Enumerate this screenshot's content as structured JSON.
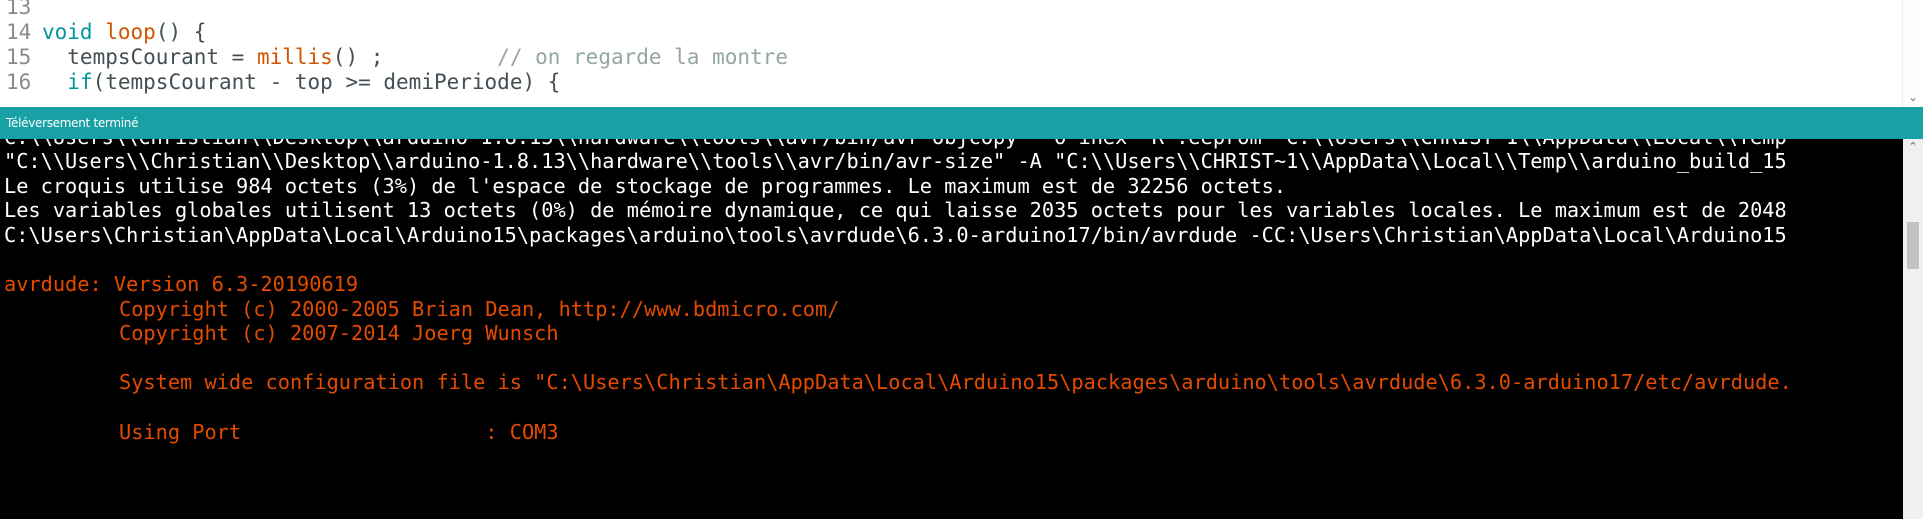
{
  "editor": {
    "lines": [
      {
        "num": "13",
        "parts": []
      },
      {
        "num": "14",
        "parts": [
          {
            "t": "void",
            "c": "kw"
          },
          {
            "t": " ",
            "c": ""
          },
          {
            "t": "loop",
            "c": "fn"
          },
          {
            "t": "() {",
            "c": ""
          }
        ]
      },
      {
        "num": "15",
        "parts": [
          {
            "t": "  tempsCourant = ",
            "c": ""
          },
          {
            "t": "millis",
            "c": "fn"
          },
          {
            "t": "() ;         ",
            "c": ""
          },
          {
            "t": "// on regarde la montre",
            "c": "cm"
          }
        ]
      },
      {
        "num": "16",
        "parts": [
          {
            "t": "  ",
            "c": ""
          },
          {
            "t": "if",
            "c": "kw"
          },
          {
            "t": "(tempsCourant - top >= demiPeriode) {",
            "c": ""
          }
        ]
      }
    ]
  },
  "status": {
    "text": "Téléversement terminé"
  },
  "console": {
    "clipped_top_line": "C:\\\\Users\\\\Christian\\\\Desktop\\\\arduino-1.8.13\\\\hardware\\\\tools\\\\avr/bin/avr-objcopy\" -O ihex -R .eeprom \"C:\\\\Users\\\\CHRIST~1\\\\AppData\\\\Local\\\\Temp",
    "lines": [
      {
        "text": "\"C:\\\\Users\\\\Christian\\\\Desktop\\\\arduino-1.8.13\\\\hardware\\\\tools\\\\avr/bin/avr-size\" -A \"C:\\\\Users\\\\CHRIST~1\\\\AppData\\\\Local\\\\Temp\\\\arduino_build_15",
        "style": "white"
      },
      {
        "text": "Le croquis utilise 984 octets (3%) de l'espace de stockage de programmes. Le maximum est de 32256 octets.",
        "style": "white"
      },
      {
        "text": "Les variables globales utilisent 13 octets (0%) de mémoire dynamique, ce qui laisse 2035 octets pour les variables locales. Le maximum est de 2048",
        "style": "white"
      },
      {
        "text": "C:\\Users\\Christian\\AppData\\Local\\Arduino15\\packages\\arduino\\tools\\avrdude\\6.3.0-arduino17/bin/avrdude -CC:\\Users\\Christian\\AppData\\Local\\Arduino15",
        "style": "white"
      },
      {
        "text": "",
        "style": "white"
      },
      {
        "text": "avrdude: Version 6.3-20190619",
        "style": "err"
      },
      {
        "text": "Copyright (c) 2000-2005 Brian Dean, http://www.bdmicro.com/",
        "style": "err indent"
      },
      {
        "text": "Copyright (c) 2007-2014 Joerg Wunsch",
        "style": "err indent"
      },
      {
        "text": "",
        "style": "err"
      },
      {
        "text": "System wide configuration file is \"C:\\Users\\Christian\\AppData\\Local\\Arduino15\\packages\\arduino\\tools\\avrdude\\6.3.0-arduino17/etc/avrdude.",
        "style": "err indent"
      },
      {
        "text": "",
        "style": "err"
      },
      {
        "text": "Using Port                    : COM3",
        "style": "err indent"
      }
    ]
  },
  "icons": {
    "editor_scroll_down": "chevron-down-icon",
    "console_scroll_up": "chevron-up-icon"
  }
}
